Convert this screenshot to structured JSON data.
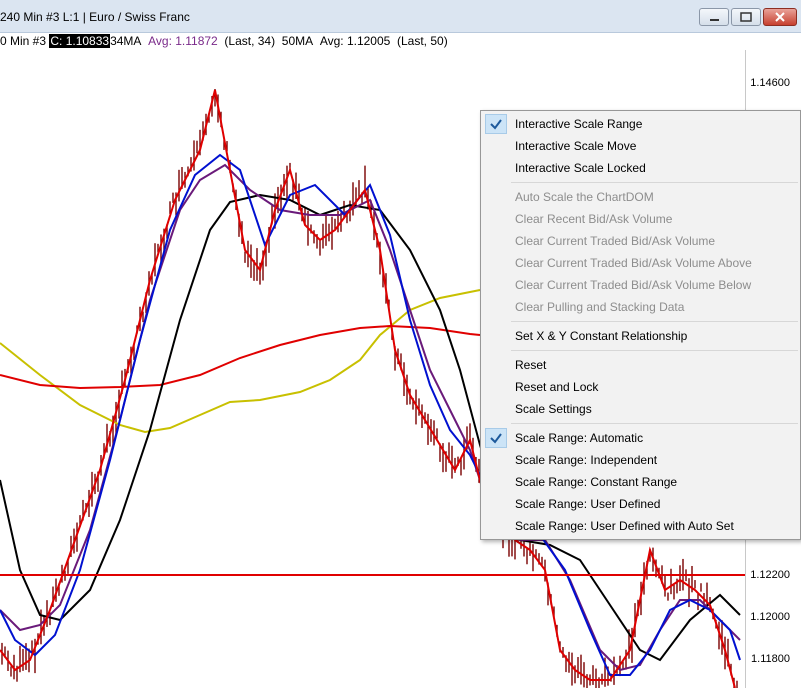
{
  "window": {
    "title": "240 Min  #3  L:1 | Euro / Swiss Franc"
  },
  "study_line": {
    "prefix": "0 Min  #3 ",
    "close": "C: 1.10833",
    "ma34_label": "34MA",
    "ma34_avg": "Avg: 1.11872",
    "ma34_last": "(Last, 34)",
    "ma50_label": "50MA",
    "ma50_avg": "Avg: 1.12005",
    "ma50_last": "(Last, 50)"
  },
  "price_axis": {
    "labels": [
      "1.14600",
      "1.12200",
      "1.12000",
      "1.11800"
    ],
    "highlighted": "1.12200"
  },
  "colors": {
    "menu_bg": "#f2f2f2",
    "check_bg": "#cce4f7",
    "disabled_text": "#8d8d8d",
    "horizontal_line": "#e00000",
    "ma_yellow": "#c8c000",
    "ma_black": "#000000",
    "ma_blue": "#0010d0",
    "ma_purple": "#6a1a7a",
    "ma_red_long": "#e00000",
    "bars": "#7a0000"
  },
  "context_menu": {
    "items": [
      {
        "label": "Interactive Scale Range",
        "checked": true,
        "disabled": false
      },
      {
        "label": "Interactive Scale Move",
        "checked": false,
        "disabled": false
      },
      {
        "label": "Interactive Scale Locked",
        "checked": false,
        "disabled": false
      },
      {
        "label": "Auto Scale the ChartDOM",
        "checked": false,
        "disabled": true
      },
      {
        "label": "Clear Recent Bid/Ask Volume",
        "checked": false,
        "disabled": true
      },
      {
        "label": "Clear Current Traded Bid/Ask Volume",
        "checked": false,
        "disabled": true
      },
      {
        "label": "Clear Current Traded Bid/Ask Volume Above",
        "checked": false,
        "disabled": true
      },
      {
        "label": "Clear Current Traded Bid/Ask Volume Below",
        "checked": false,
        "disabled": true
      },
      {
        "label": "Clear Pulling and Stacking Data",
        "checked": false,
        "disabled": true
      },
      {
        "label": "Set X & Y Constant Relationship",
        "checked": false,
        "disabled": false
      },
      {
        "label": "Reset",
        "checked": false,
        "disabled": false
      },
      {
        "label": "Reset and Lock",
        "checked": false,
        "disabled": false
      },
      {
        "label": "Scale Settings",
        "checked": false,
        "disabled": false
      },
      {
        "label": "Scale Range: Automatic",
        "checked": true,
        "disabled": false
      },
      {
        "label": "Scale Range: Independent",
        "checked": false,
        "disabled": false
      },
      {
        "label": "Scale Range: Constant Range",
        "checked": false,
        "disabled": false
      },
      {
        "label": "Scale Range: User Defined",
        "checked": false,
        "disabled": false
      },
      {
        "label": "Scale Range: User Defined with Auto Set",
        "checked": false,
        "disabled": false
      }
    ]
  }
}
